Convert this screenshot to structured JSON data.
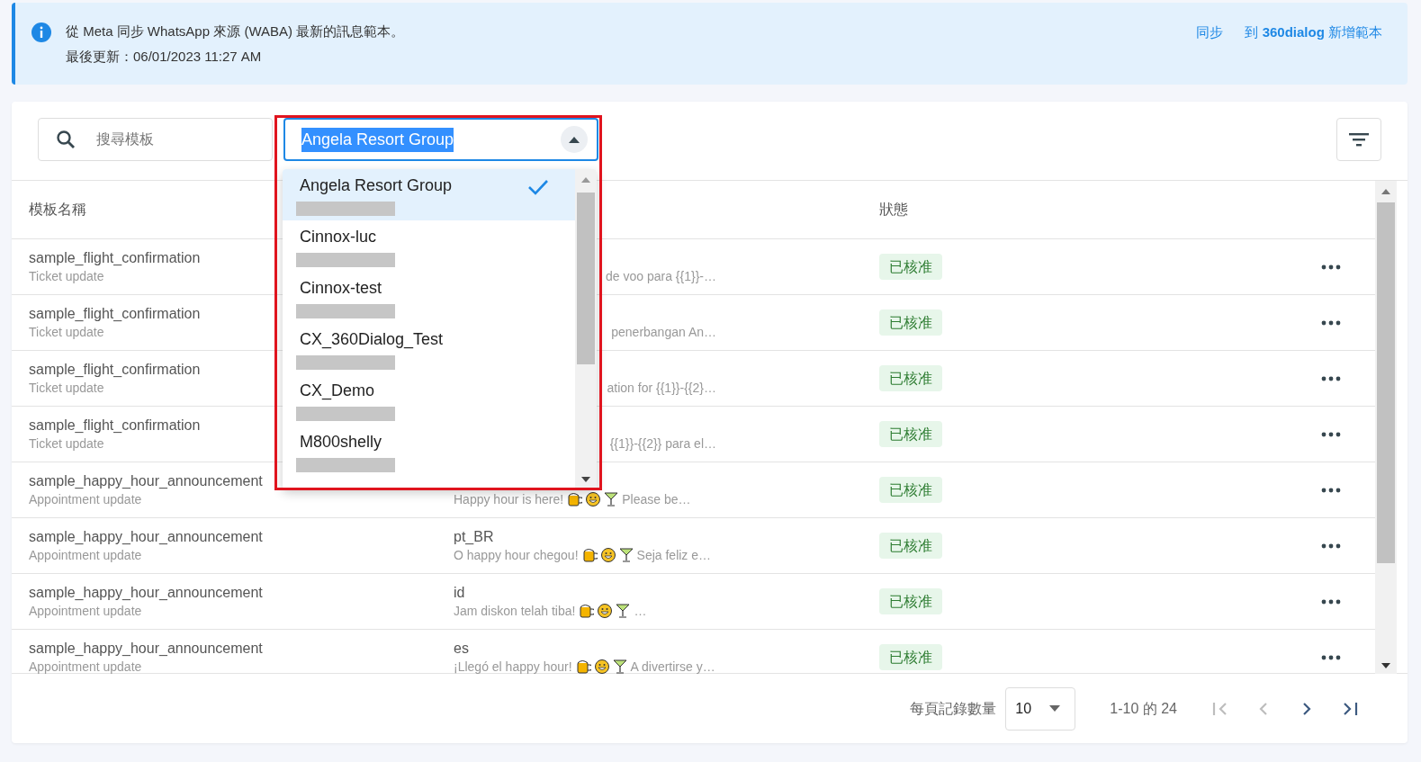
{
  "banner": {
    "message": "從 Meta 同步 WhatsApp 來源 (WABA) 最新的訊息範本。",
    "updated": "最後更新：06/01/2023 11:27 AM",
    "actions": [
      "同步",
      "到 **360dialog** 新增範本"
    ]
  },
  "search": {
    "placeholder": "搜尋模板"
  },
  "account_select": {
    "value": "Angela Resort Group",
    "expanded": true,
    "options": [
      {
        "name": "Angela Resort Group",
        "selected": true,
        "redacted": true
      },
      {
        "name": "Cinnox-luc",
        "selected": false,
        "redacted": true
      },
      {
        "name": "Cinnox-test",
        "selected": false,
        "redacted": true
      },
      {
        "name": "CX_360Dialog_Test",
        "selected": false,
        "redacted": true
      },
      {
        "name": "CX_Demo",
        "selected": false,
        "redacted": true
      },
      {
        "name": "M800shelly",
        "selected": false,
        "redacted": true
      }
    ]
  },
  "table": {
    "headers": {
      "name": "模板名稱",
      "status": "狀態"
    },
    "rows": [
      {
        "name": "sample_flight_confirmation",
        "category": "Ticket update",
        "preview": "de voo para {{1}}-…",
        "covered": true,
        "emoji": false,
        "status": "已核准"
      },
      {
        "name": "sample_flight_confirmation",
        "category": "Ticket update",
        "preview": "penerbangan An…",
        "covered": true,
        "emoji": false,
        "status": "已核准"
      },
      {
        "name": "sample_flight_confirmation",
        "category": "Ticket update",
        "preview": "ation for {{1}}-{{2}…",
        "covered": true,
        "emoji": false,
        "status": "已核准"
      },
      {
        "name": "sample_flight_confirmation",
        "category": "Ticket update",
        "preview": "{{1}}-{{2}} para el…",
        "covered": true,
        "emoji": false,
        "status": "已核准"
      },
      {
        "name": "sample_happy_hour_announcement",
        "category": "Appointment update",
        "preview": "Happy hour is here!",
        "emoji": true,
        "preview_after": "Please be…",
        "covered": false,
        "status": "已核准"
      },
      {
        "name": "sample_happy_hour_announcement",
        "category": "Appointment update",
        "language": "pt_BR",
        "preview": "O happy hour chegou!",
        "emoji": true,
        "preview_after": "Seja feliz e…",
        "covered": false,
        "status": "已核准"
      },
      {
        "name": "sample_happy_hour_announcement",
        "category": "Appointment update",
        "language": "id",
        "preview": "Jam diskon telah tiba!",
        "emoji": true,
        "preview_after": "…",
        "covered": false,
        "status": "已核准"
      },
      {
        "name": "sample_happy_hour_announcement",
        "category": "Appointment update",
        "language": "es",
        "preview": "¡Llegó el happy hour!",
        "emoji": true,
        "preview_after": "A divertirse y…",
        "covered": false,
        "status": "已核准"
      }
    ]
  },
  "pagination": {
    "label": "每頁記錄數量",
    "per_page": "10",
    "range": "1-10 的 24",
    "buttons": [
      {
        "kind": "first",
        "disabled": true
      },
      {
        "kind": "prev",
        "disabled": true
      },
      {
        "kind": "next",
        "disabled": false
      },
      {
        "kind": "last",
        "disabled": false
      }
    ]
  }
}
